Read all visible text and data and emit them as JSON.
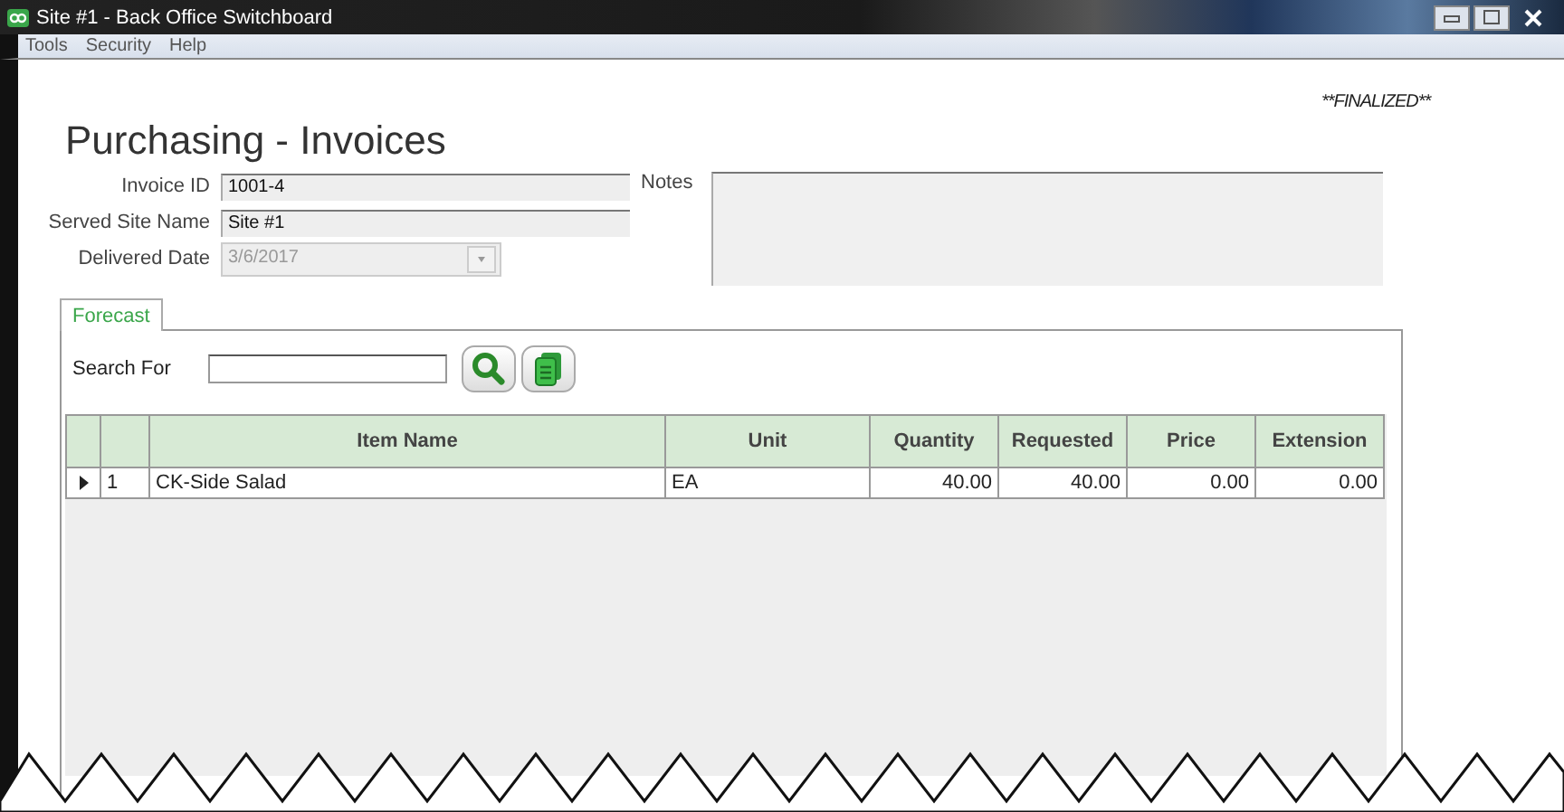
{
  "window": {
    "title": "Site #1 - Back Office Switchboard"
  },
  "menu": [
    "Tools",
    "Security",
    "Help"
  ],
  "page_title": "Purchasing - Invoices",
  "status": "**FINALIZED**",
  "fields": [
    {
      "label": "Invoice ID",
      "value": "1001-4",
      "disabled": false
    },
    {
      "label": "Served Site Name",
      "value": "Site #1",
      "disabled": false
    },
    {
      "label": "Delivered Date",
      "value": "3/6/2017",
      "disabled": true
    }
  ],
  "notes": {
    "label": "Notes"
  },
  "tabs": [
    {
      "label": "Forecast",
      "selected": true
    }
  ],
  "search": {
    "label": "Search For"
  },
  "table": {
    "columns": [
      "Item Name",
      "Unit",
      "Quantity",
      "Requested",
      "Price",
      "Extension"
    ],
    "rows": [
      {
        "number": "1",
        "cells": [
          "CK-Side Salad",
          "EA",
          "40.00",
          "40.00",
          "0.00",
          "0.00"
        ]
      }
    ]
  }
}
